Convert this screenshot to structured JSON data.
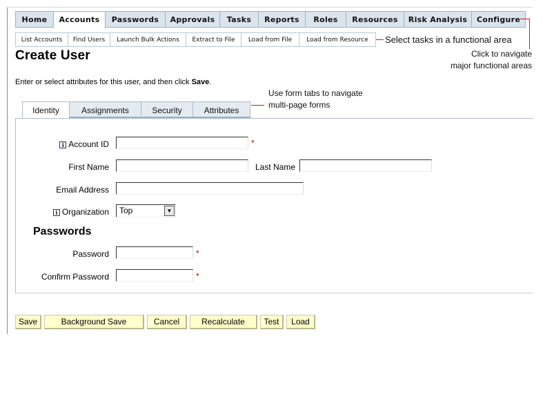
{
  "top_nav": [
    "Home",
    "Accounts",
    "Passwords",
    "Approvals",
    "Tasks",
    "Reports",
    "Roles",
    "Resources",
    "Risk Analysis",
    "Configure"
  ],
  "top_nav_active": "Accounts",
  "sub_nav": [
    "List Accounts",
    "Find Users",
    "Launch Bulk Actions",
    "Extract to File",
    "Load from File",
    "Load from Resource"
  ],
  "annotations": {
    "subnav_hint": "Select tasks in a functional area",
    "topnav_hint_line1": "Click to navigate",
    "topnav_hint_line2": "major functional areas",
    "formtabs_hint_line1": "Use form tabs to navigate",
    "formtabs_hint_line2": "multi-page forms"
  },
  "page_title": "Create User",
  "intro": {
    "text": "Enter or select attributes for this user, and then click ",
    "bold": "Save",
    "end": "."
  },
  "form_tabs": [
    "Identity",
    "Assignments",
    "Security",
    "Attributes"
  ],
  "form_tabs_active": "Identity",
  "fields": {
    "account_id": {
      "label": "Account ID",
      "value": "",
      "required": "*"
    },
    "first_name": {
      "label": "First Name",
      "value": ""
    },
    "last_name": {
      "label": "Last Name",
      "value": ""
    },
    "email": {
      "label": "Email Address",
      "value": ""
    },
    "organization": {
      "label": "Organization",
      "value": "Top"
    }
  },
  "info_icon_glyph": "i",
  "dropdown_glyph": "▼",
  "passwords_section": {
    "title": "Passwords",
    "password": {
      "label": "Password",
      "value": "",
      "required": "*"
    },
    "confirm": {
      "label": "Confirm Password",
      "value": "",
      "required": "*"
    }
  },
  "buttons": [
    "Save",
    "Background Save",
    "Cancel",
    "Recalculate",
    "Test",
    "Load"
  ],
  "colors": {
    "accent_red": "#d11111",
    "tab_bg": "#d9e4ec",
    "button_bg": "#ffffcc"
  }
}
